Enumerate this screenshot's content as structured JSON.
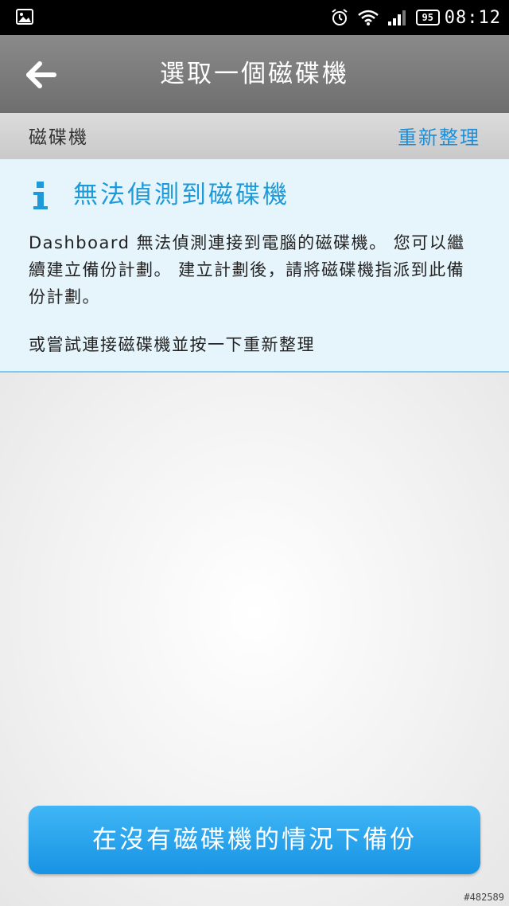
{
  "status_bar": {
    "battery": "95",
    "time": "08:12",
    "icons": [
      "image-icon",
      "alarm-icon",
      "wifi-icon",
      "signal-icon",
      "battery-icon"
    ]
  },
  "header": {
    "title": "選取一個磁碟機",
    "back_icon": "back-arrow-icon"
  },
  "section": {
    "label": "磁碟機",
    "refresh_label": "重新整理",
    "accent_color": "#1e8fd8"
  },
  "info": {
    "icon": "info-icon",
    "heading": "無法偵測到磁碟機",
    "body": "Dashboard 無法偵測連接到電腦的磁碟機。 您可以繼續建立備份計劃。 建立計劃後，請將磁碟機指派到此備份計劃。",
    "body2": "或嘗試連接磁碟機並按一下重新整理"
  },
  "footer": {
    "backup_button_label": "在沒有磁碟機的情況下備份",
    "watermark": "#482589"
  }
}
